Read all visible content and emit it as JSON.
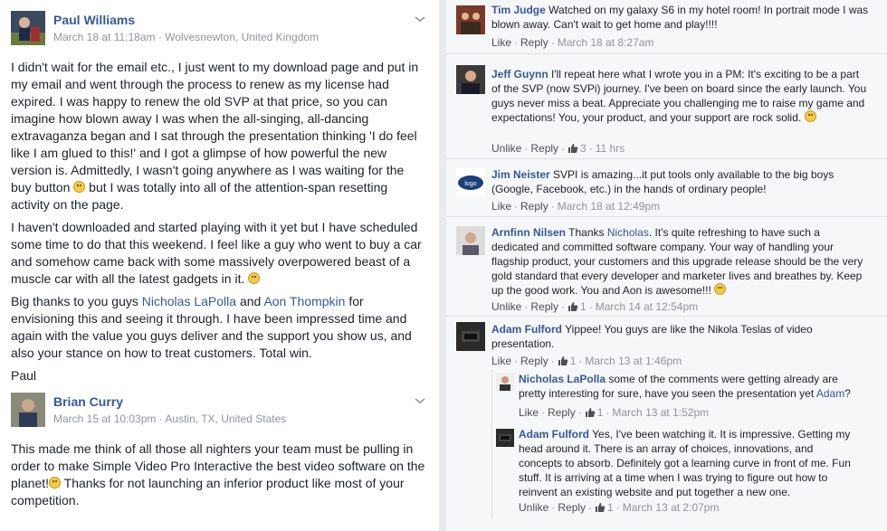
{
  "post1": {
    "author": "Paul Williams",
    "meta": "March 18 at 11:18am · Wolvesnewton, United Kingdom",
    "para1": "I didn't wait for the email etc., I just went to my download page and put in my email and went through the process to renew as my license had expired. I was happy to renew the old SVP at that price, so you can imagine how blown away I was when the all-singing, all-dancing extravaganza began and I sat through the presentation thinking 'I do feel like I am glued to this!' and I got a glimpse of how powerful the new version is. Admittedly, I wasn't going anywhere as I was waiting for the buy button",
    "para1b": " but I was totally into all of the attention-span resetting activity on the page.",
    "para2": "I haven't downloaded and started playing with it yet but I have scheduled some time to do that this weekend. I feel like a guy who went to buy a car and somehow came back with some massively overpowered beast of a muscle car with all the latest gadgets in it.",
    "para3a": "Big thanks to you guys ",
    "link1": "Nicholas LaPolla",
    "para3b": " and ",
    "link2": "Aon Thompkin",
    "para3c": " for envisioning this and seeing it through. I have been impressed time and again with the value you guys deliver and the support you show us, and also your stance on how to treat customers. Total win.",
    "signoff": "Paul"
  },
  "post2": {
    "author": "Brian Curry",
    "meta": "March 15 at 10:03pm · Austin, TX, United States",
    "bodyA": "This made me think of all those all nighters your team must be pulling in order to make Simple Video Pro Interactive the best video software on the planet!",
    "bodyB": " Thanks for not launching an inferior product like most of your competition."
  },
  "comments": [
    {
      "name": "Tim Judge",
      "text": "Watched on my galaxy S6 in my hotel room! In portrait mode I was blown away. Can't wait to get home and play!!!!",
      "a1": "Like",
      "a2": "Reply",
      "likes": "",
      "time": "March 18 at 8:27am"
    },
    {
      "name": "Jeff Guynn",
      "text": "I'll repeat here what I wrote you in a PM: It's exciting to be a part of the SVP (now SVPi) journey. I've been on board since the early launch. You guys never miss a beat. Appreciate you challenging me to raise my game and expectations! You, your product, and your support are rock solid.",
      "a1": "Unlike",
      "a2": "Reply",
      "likes": "3",
      "time": "11 hrs"
    },
    {
      "name": "Jim Neister",
      "text": "SVPI is amazing...it put tools only available to the big boys (Google, Facebook, etc.) in the hands of ordinary people!",
      "a1": "Like",
      "a2": "Reply",
      "likes": "",
      "time": "March 18 at 12:49pm"
    },
    {
      "name": "Arnfinn Nilsen",
      "textA": "Thanks ",
      "link": "Nicholas",
      "textB": ". It's quite refreshing to have such a dedicated and committed software company. Your way of handling your flagship product, your customers and this upgrade release should be the very gold standard that every developer and marketer lives and breathes by. Keep up the good work. You and Aon is awesome!!!",
      "a1": "Unlike",
      "a2": "Reply",
      "likes": "1",
      "time": "March 14 at 12:54pm"
    },
    {
      "name": "Adam Fulford",
      "text": "Yippee! You guys are like the Nikola Teslas of video presentation.",
      "a1": "Like",
      "a2": "Reply",
      "likes": "1",
      "time": "March 13 at 1:46pm"
    }
  ],
  "replies": [
    {
      "name": "Nicholas LaPolla",
      "text": "some of the comments were getting already are pretty interesting for sure, have you seen the presentation yet ",
      "link": "Adam",
      "tail": "?",
      "a1": "Like",
      "a2": "Reply",
      "likes": "1",
      "time": "March 13 at 1:52pm"
    },
    {
      "name": "Adam Fulford",
      "text": "Yes, I've been watching it. It is impressive. Getting my head around it. There is an array of choices, innovations, and concepts to absorb. Definitely got a learning curve in front of me. Fun stuff. It is arriving at a time when I was trying to figure out how to reinvent an existing website and put together a new one.",
      "a1": "Unlike",
      "a2": "Reply",
      "likes": "1",
      "time": "March 13 at 2:07pm"
    }
  ],
  "colors": {
    "link": "#365899",
    "meta": "#90949c",
    "bg_right": "#f6f7f9",
    "gap": "#e9ebee"
  }
}
